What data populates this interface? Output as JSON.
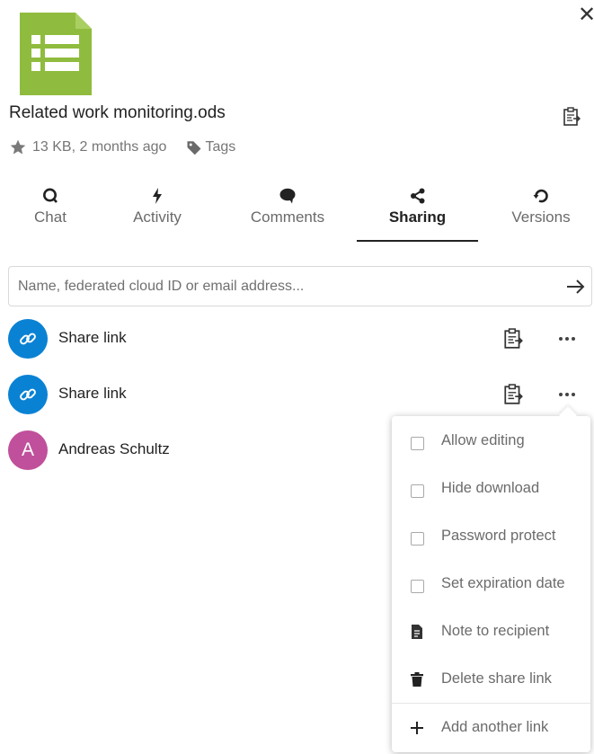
{
  "header": {
    "close_icon": "close-icon",
    "file_icon": "spreadsheet-icon",
    "file_icon_color": "#8fbc3e",
    "file_name": "Related work monitoring.ods",
    "meta_text": "13 KB, 2 months ago",
    "tags_label": "Tags"
  },
  "tabs": [
    {
      "label": "Chat",
      "icon": "chat-icon"
    },
    {
      "label": "Activity",
      "icon": "lightning-icon"
    },
    {
      "label": "Comments",
      "icon": "comment-bubble-icon"
    },
    {
      "label": "Sharing",
      "icon": "share-icon",
      "active": true
    },
    {
      "label": "Versions",
      "icon": "history-icon"
    }
  ],
  "search": {
    "placeholder": "Name, federated cloud ID or email address...",
    "value": ""
  },
  "shares": [
    {
      "type": "link",
      "label": "Share link"
    },
    {
      "type": "link",
      "label": "Share link"
    },
    {
      "type": "user",
      "initial": "A",
      "label": "Andreas Schultz"
    }
  ],
  "menu": {
    "items": [
      {
        "label": "Allow editing",
        "kind": "checkbox",
        "checked": false
      },
      {
        "label": "Hide download",
        "kind": "checkbox",
        "checked": false
      },
      {
        "label": "Password protect",
        "kind": "checkbox",
        "checked": false
      },
      {
        "label": "Set expiration date",
        "kind": "checkbox",
        "checked": false
      },
      {
        "label": "Note to recipient",
        "kind": "action",
        "icon": "note-icon"
      },
      {
        "label": "Delete share link",
        "kind": "action",
        "icon": "trash-icon"
      },
      {
        "label": "Add another link",
        "kind": "action",
        "icon": "plus-icon"
      }
    ]
  },
  "colors": {
    "link_avatar": "#0a82d4",
    "user_avatar": "#c0509b",
    "active_tab": "#222222"
  }
}
